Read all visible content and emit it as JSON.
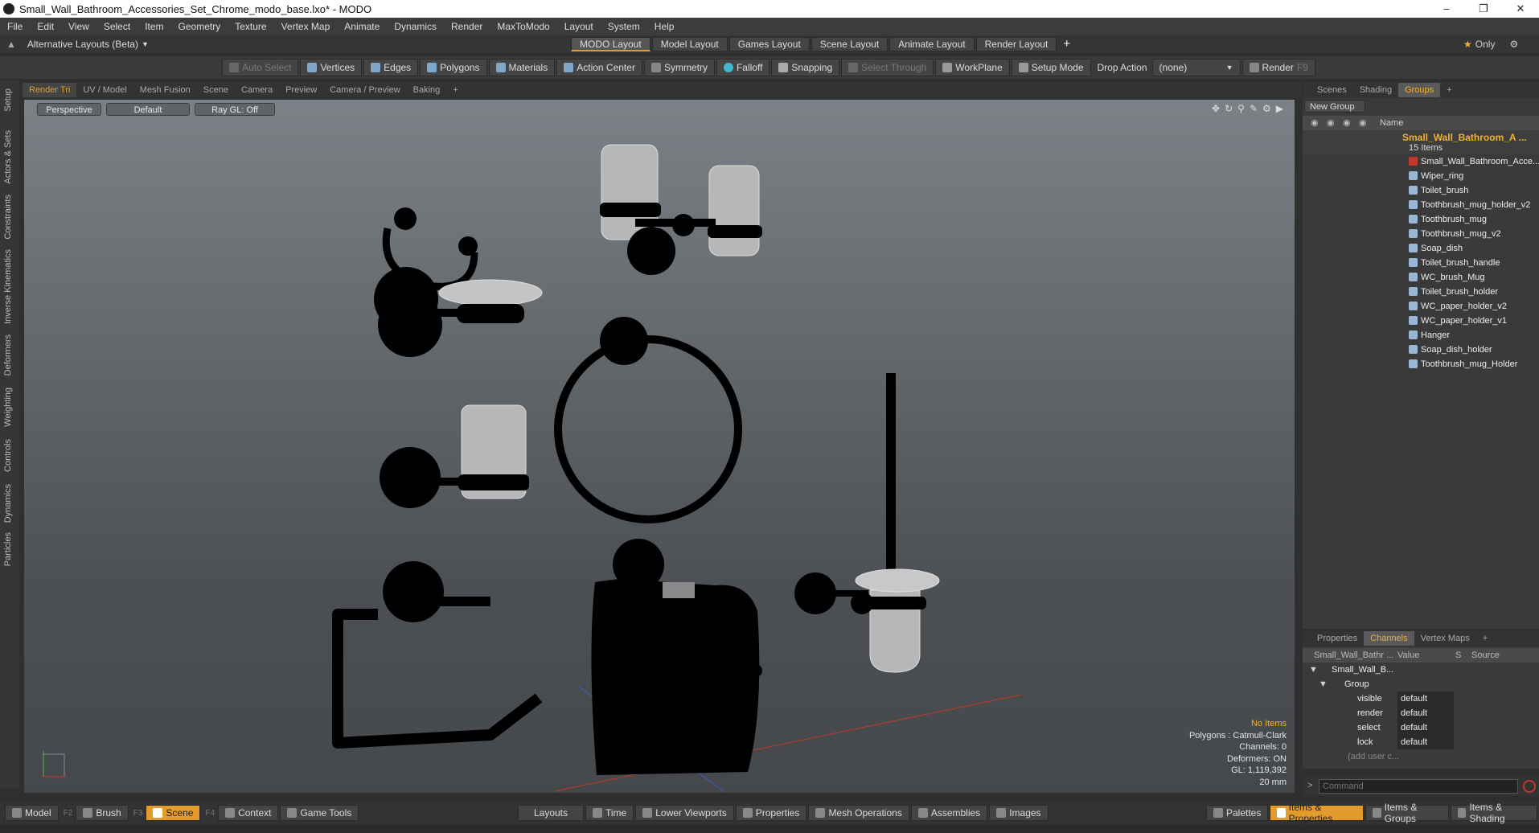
{
  "title": "Small_Wall_Bathroom_Accessories_Set_Chrome_modo_base.lxo* - MODO",
  "menu": [
    "File",
    "Edit",
    "View",
    "Select",
    "Item",
    "Geometry",
    "Texture",
    "Vertex Map",
    "Animate",
    "Dynamics",
    "Render",
    "MaxToModo",
    "Layout",
    "System",
    "Help"
  ],
  "layout": {
    "alt_label": "Alternative Layouts (Beta)",
    "tabs": [
      "MODO Layout",
      "Model Layout",
      "Games Layout",
      "Scene Layout",
      "Animate Layout",
      "Render Layout"
    ],
    "add": "+",
    "only": "Only"
  },
  "toolbar": {
    "auto_select": "Auto Select",
    "vertices": "Vertices",
    "edges": "Edges",
    "polygons": "Polygons",
    "materials": "Materials",
    "action_center": "Action Center",
    "symmetry": "Symmetry",
    "falloff": "Falloff",
    "snapping": "Snapping",
    "select_through": "Select Through",
    "workplane": "WorkPlane",
    "setup_mode": "Setup Mode",
    "drop_action": "Drop Action",
    "drop_value": "(none)",
    "render": "Render",
    "render_key": "F9"
  },
  "left_tabs": [
    "Setup",
    "Actors & Sets",
    "Constraints",
    "Inverse Kinematics",
    "Deformers",
    "Weighting",
    "Controls",
    "Dynamics",
    "Particles"
  ],
  "viewport_tabs": [
    "Render Tri",
    "UV / Model",
    "Mesh Fusion",
    "Scene",
    "Camera",
    "Preview",
    "Camera / Preview",
    "Baking",
    "+"
  ],
  "viewport": {
    "perspective": "Perspective",
    "default": "Default",
    "raygl": "Ray GL: Off",
    "info": {
      "items": "No Items",
      "polygons": "Polygons : Catmull-Clark",
      "channels": "Channels: 0",
      "deformers": "Deformers: ON",
      "gl": "GL: 1,119,392",
      "size": "20 mm"
    }
  },
  "scene_panel": {
    "tabs": [
      "Scenes",
      "Shading",
      "Groups",
      "+"
    ],
    "new_group": "New Group",
    "col_name": "Name",
    "root": "Small_Wall_Bathroom_A ...",
    "root_count": "15 Items",
    "items": [
      "Small_Wall_Bathroom_Acce...",
      "Wiper_ring",
      "Toilet_brush",
      "Toothbrush_mug_holder_v2",
      "Toothbrush_mug",
      "Toothbrush_mug_v2",
      "Soap_dish",
      "Toilet_brush_handle",
      "WC_brush_Mug",
      "Toilet_brush_holder",
      "WC_paper_holder_v2",
      "WC_paper_holder_v1",
      "Hanger",
      "Soap_dish_holder",
      "Toothbrush_mug_Holder"
    ]
  },
  "channels_panel": {
    "tabs": [
      "Properties",
      "Channels",
      "Vertex Maps",
      "+"
    ],
    "headers": [
      "Small_Wall_Bathr ...",
      "Value",
      "S",
      "Source"
    ],
    "item": "Small_Wall_B...",
    "group": "Group",
    "rows": [
      {
        "name": "visible",
        "value": "default"
      },
      {
        "name": "render",
        "value": "default"
      },
      {
        "name": "select",
        "value": "default"
      },
      {
        "name": "lock",
        "value": "default"
      }
    ],
    "add": "(add user c..."
  },
  "command": {
    "placeholder": "Command"
  },
  "bottom": {
    "left": [
      {
        "label": "Model",
        "key": "F2"
      },
      {
        "label": "Brush",
        "key": "F3"
      },
      {
        "label": "Scene",
        "key": "F4"
      },
      {
        "label": "Context",
        "key": ""
      },
      {
        "label": "Game Tools",
        "key": ""
      }
    ],
    "mid": [
      "Layouts",
      "Time",
      "Lower Viewports",
      "Properties",
      "Mesh Operations",
      "Assemblies",
      "Images"
    ],
    "right": [
      "Palettes",
      "Items & Properties",
      "Items & Groups",
      "Items & Shading"
    ]
  },
  "accent": "#e39b2d"
}
